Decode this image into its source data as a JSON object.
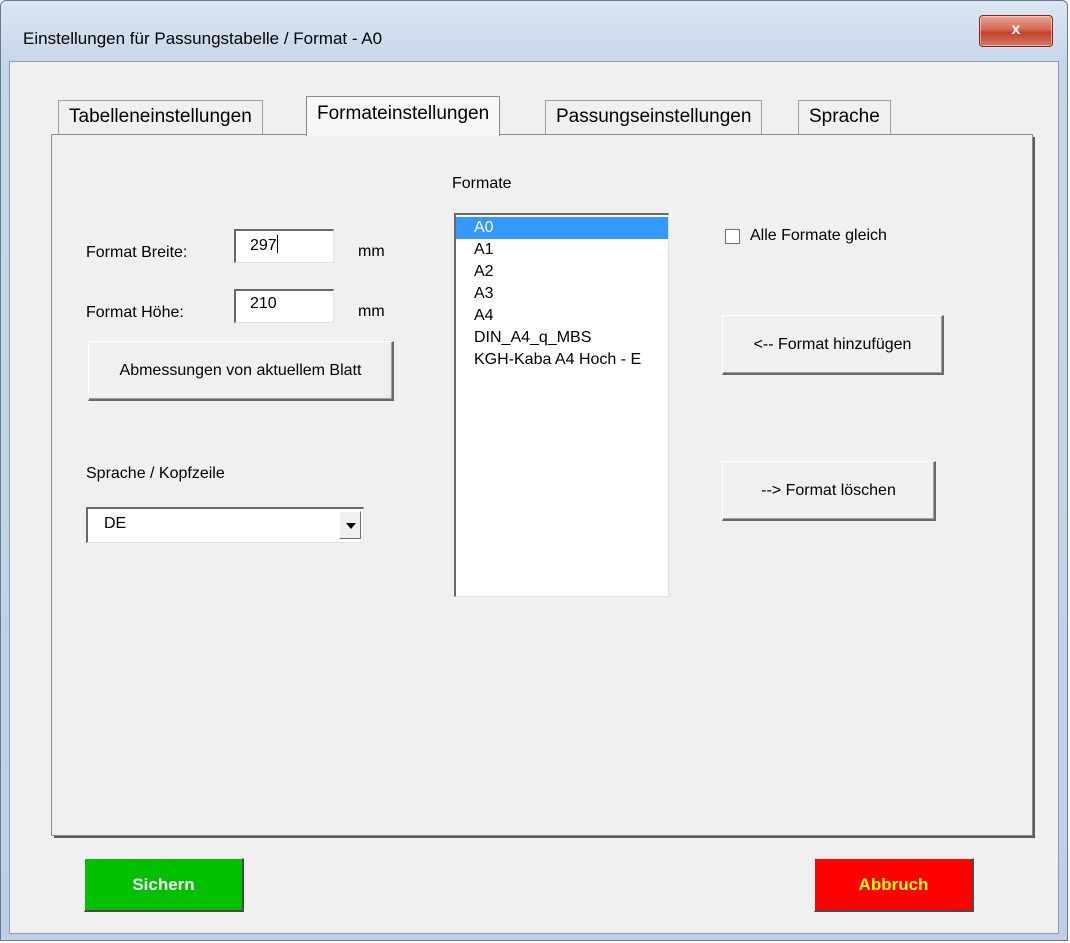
{
  "window": {
    "title": "Einstellungen für Passungstabelle / Format - A0",
    "close_label": "x"
  },
  "tabs": [
    {
      "label": "Tabelleneinstellungen",
      "active": false
    },
    {
      "label": "Formateinstellungen",
      "active": true
    },
    {
      "label": "Passungseinstellungen",
      "active": false
    },
    {
      "label": "Sprache",
      "active": false
    }
  ],
  "format": {
    "width_label": "Format Breite:",
    "width_value": "297",
    "width_unit": "mm",
    "height_label": "Format Höhe:",
    "height_value": "210",
    "height_unit": "mm",
    "dimensions_button": "Abmessungen von aktuellem Blatt"
  },
  "language": {
    "label": "Sprache / Kopfzeile",
    "selected": "DE"
  },
  "formats": {
    "label": "Formate",
    "items": [
      "A0",
      "A1",
      "A2",
      "A3",
      "A4",
      "DIN_A4_q_MBS",
      "KGH-Kaba A4 Hoch - E"
    ],
    "selected_index": 0
  },
  "options": {
    "all_formats_label": "Alle Formate gleich",
    "all_formats_checked": false
  },
  "actions": {
    "add_format": "<-- Format hinzufügen",
    "delete_format": "--> Format löschen"
  },
  "footer": {
    "save": "Sichern",
    "save_color": "#00c000",
    "cancel": "Abbruch",
    "cancel_color": "#ff0000",
    "cancel_text_color": "#ffff00"
  }
}
